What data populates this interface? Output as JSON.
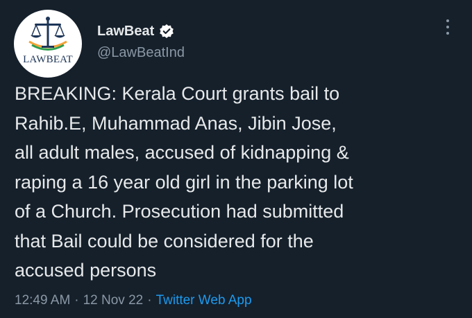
{
  "tweet": {
    "avatar_label": "LAWBEAT",
    "display_name": "LawBeat",
    "handle": "@LawBeatInd",
    "text": "BREAKING: Kerala Court grants bail to\nRahib.E, Muhammad Anas, Jibin Jose,\nall adult males, accused of kidnapping &\nraping a 16 year old girl in the parking lot\nof a Church. Prosecution had submitted\nthat Bail could be considered for the\naccused persons",
    "time": "12:49 AM",
    "separator1": "·",
    "date": "12 Nov 22",
    "separator2": "·",
    "source": "Twitter Web App"
  },
  "icons": {
    "verified": "verified-badge-icon",
    "more": "more-options-icon",
    "avatar_logo": "scales-of-justice-icon"
  },
  "colors": {
    "background": "#15202b",
    "text": "#e7e9ea",
    "secondary": "#8b98a5",
    "link": "#1d9bf0"
  }
}
